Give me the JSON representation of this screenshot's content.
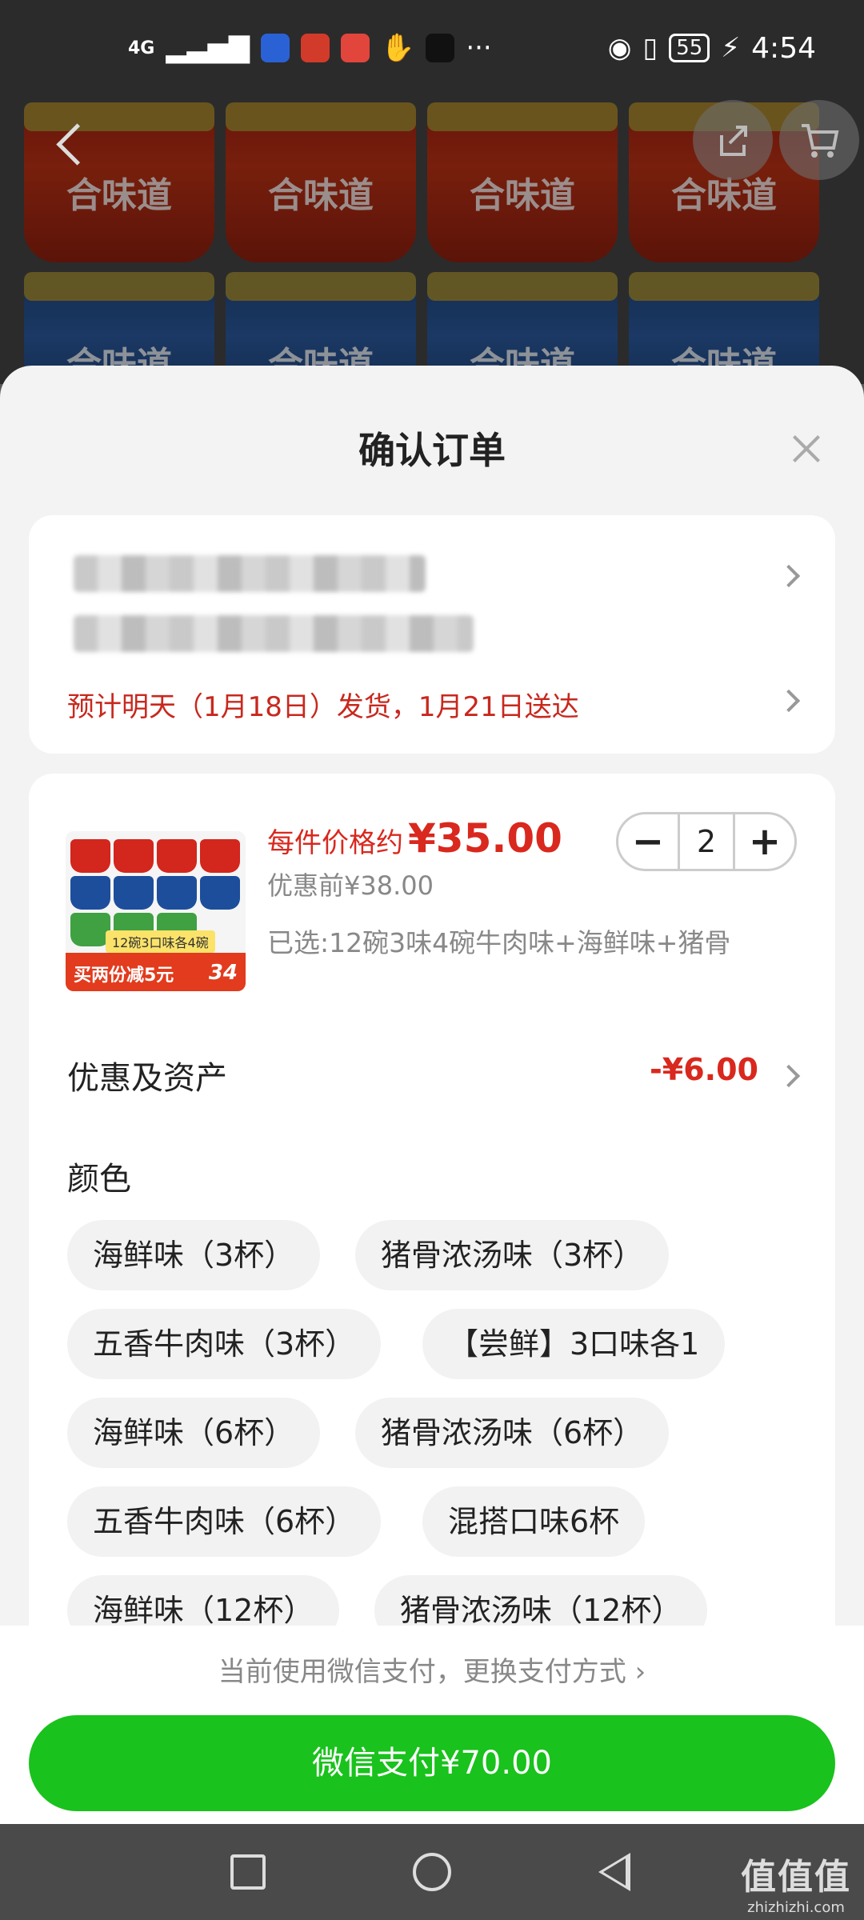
{
  "status_bar": {
    "network": "4G",
    "battery": "55",
    "time": "4:54"
  },
  "background": {
    "product_logo": "合味道"
  },
  "sheet": {
    "title": "确认订单"
  },
  "address": {
    "delivery_note": "预计明天（1月18日）发货，1月21日送达"
  },
  "product": {
    "price_label": "每件价格约",
    "price": "¥35.00",
    "original_price": "优惠前¥38.00",
    "selected_spec": "已选:12碗3味4碗牛肉味+海鲜味+猪骨",
    "quantity": "2",
    "minus": "−",
    "plus": "+",
    "thumb_tag_left": "买两份减5元",
    "thumb_tag_right": "34",
    "thumb_tag_note": "12碗3口味各4碗"
  },
  "promo": {
    "label": "优惠及资产",
    "value": "-¥6.00"
  },
  "color": {
    "label": "颜色",
    "options": [
      "海鲜味（3杯）",
      "猪骨浓汤味（3杯）",
      "五香牛肉味（3杯）",
      "【尝鲜】3口味各1",
      "海鲜味（6杯）",
      "猪骨浓汤味（6杯）",
      "五香牛肉味（6杯）",
      "混搭口味6杯",
      "海鲜味（12杯）",
      "猪骨浓汤味（12杯）"
    ]
  },
  "payment": {
    "hint": "当前使用微信支付，更换支付方式 ›",
    "button": "微信支付¥70.00"
  },
  "watermark": {
    "line1": "值值值",
    "line2": "zhizhizhi.com"
  },
  "colors": {
    "accent_red": "#d9281e",
    "pay_green": "#19c21c"
  }
}
